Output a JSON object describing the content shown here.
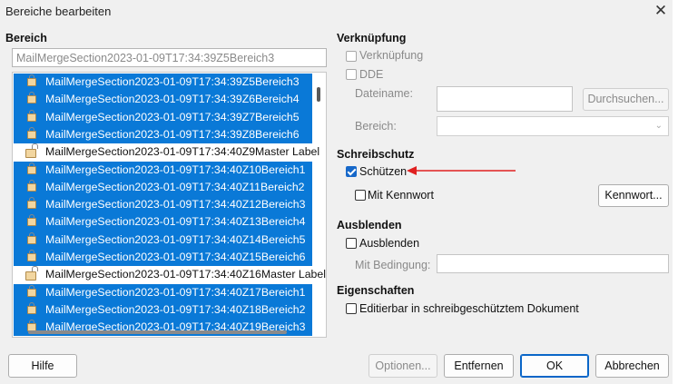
{
  "window": {
    "title": "Bereiche bearbeiten",
    "close_icon": "close-icon"
  },
  "bereich": {
    "header": "Bereich",
    "name_value": "MailMergeSection2023-01-09T17:34:39Z5Bereich3",
    "items": [
      {
        "label": "MailMergeSection2023-01-09T17:34:39Z5Bereich3",
        "selected": true,
        "locked": true
      },
      {
        "label": "MailMergeSection2023-01-09T17:34:39Z6Bereich4",
        "selected": true,
        "locked": true
      },
      {
        "label": "MailMergeSection2023-01-09T17:34:39Z7Bereich5",
        "selected": true,
        "locked": true
      },
      {
        "label": "MailMergeSection2023-01-09T17:34:39Z8Bereich6",
        "selected": true,
        "locked": true
      },
      {
        "label": "MailMergeSection2023-01-09T17:34:40Z9Master Label",
        "selected": false,
        "locked": false
      },
      {
        "label": "MailMergeSection2023-01-09T17:34:40Z10Bereich1",
        "selected": true,
        "locked": true
      },
      {
        "label": "MailMergeSection2023-01-09T17:34:40Z11Bereich2",
        "selected": true,
        "locked": true
      },
      {
        "label": "MailMergeSection2023-01-09T17:34:40Z12Bereich3",
        "selected": true,
        "locked": true
      },
      {
        "label": "MailMergeSection2023-01-09T17:34:40Z13Bereich4",
        "selected": true,
        "locked": true
      },
      {
        "label": "MailMergeSection2023-01-09T17:34:40Z14Bereich5",
        "selected": true,
        "locked": true
      },
      {
        "label": "MailMergeSection2023-01-09T17:34:40Z15Bereich6",
        "selected": true,
        "locked": true
      },
      {
        "label": "MailMergeSection2023-01-09T17:34:40Z16Master Label",
        "selected": false,
        "locked": false
      },
      {
        "label": "MailMergeSection2023-01-09T17:34:40Z17Bereich1",
        "selected": true,
        "locked": true
      },
      {
        "label": "MailMergeSection2023-01-09T17:34:40Z18Bereich2",
        "selected": true,
        "locked": true
      },
      {
        "label": "MailMergeSection2023-01-09T17:34:40Z19Bereich3",
        "selected": true,
        "locked": true
      }
    ]
  },
  "verknuepfung": {
    "header": "Verknüpfung",
    "link_checkbox": {
      "label": "Verknüpfung",
      "checked": false
    },
    "dde_checkbox": {
      "label": "DDE",
      "checked": false
    },
    "dateiname_label": "Dateiname:",
    "dateiname_value": "",
    "browse_button": "Durchsuchen...",
    "bereich_label": "Bereich:",
    "bereich_value": ""
  },
  "schreibschutz": {
    "header": "Schreibschutz",
    "protect_checkbox": {
      "label": "Schützen",
      "checked": true
    },
    "password_checkbox": {
      "label": "Mit Kennwort",
      "checked": false
    },
    "password_button": "Kennwort..."
  },
  "ausblenden": {
    "header": "Ausblenden",
    "hide_checkbox": {
      "label": "Ausblenden",
      "checked": false
    },
    "condition_label": "Mit Bedingung:",
    "condition_value": ""
  },
  "eigenschaften": {
    "header": "Eigenschaften",
    "editable_checkbox": {
      "label": "Editierbar in schreibgeschütztem Dokument",
      "checked": false
    }
  },
  "buttons": {
    "help": "Hilfe",
    "options": "Optionen...",
    "remove": "Entfernen",
    "ok": "OK",
    "cancel": "Abbrechen"
  },
  "colors": {
    "selection": "#0a79d7",
    "arrow": "#e02020",
    "checkbox_checked": "#1668c9"
  }
}
